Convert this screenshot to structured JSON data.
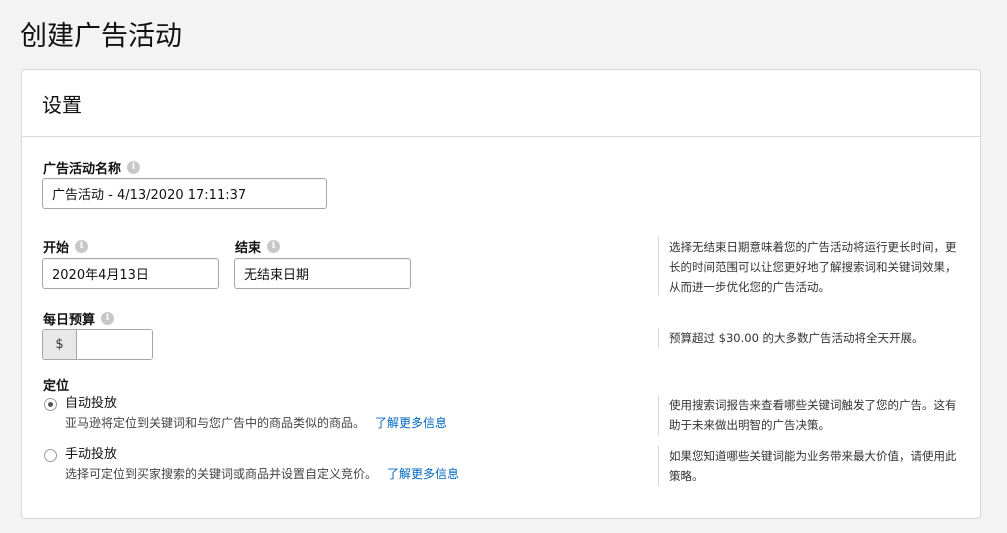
{
  "page": {
    "title": "创建广告活动"
  },
  "settings": {
    "header": "设置",
    "campaign_name": {
      "label": "广告活动名称",
      "value": "广告活动 - 4/13/2020 17:11:37"
    },
    "start": {
      "label": "开始",
      "value": "2020年4月13日"
    },
    "end": {
      "label": "结束",
      "value": "无结束日期"
    },
    "date_hint": "选择无结束日期意味着您的广告活动将运行更长时间，更长的时间范围可以让您更好地了解搜索词和关键词效果，从而进一步优化您的广告活动。",
    "budget": {
      "label": "每日预算",
      "currency": "$",
      "value": ""
    },
    "budget_hint": "预算超过 $30.00 的大多数广告活动将全天开展。",
    "targeting": {
      "label": "定位",
      "auto": {
        "title": "自动投放",
        "desc": "亚马逊将定位到关键词和与您广告中的商品类似的商品。",
        "link": "了解更多信息",
        "selected": true,
        "hint": "使用搜索词报告来查看哪些关键词触发了您的广告。这有助于未来做出明智的广告决策。"
      },
      "manual": {
        "title": "手动投放",
        "desc": "选择可定位到买家搜索的关键词或商品并设置自定义竞价。",
        "link": "了解更多信息",
        "selected": false,
        "hint": "如果您知道哪些关键词能为业务带来最大价值，请使用此策略。"
      }
    }
  },
  "icons": {
    "info": "info-icon"
  },
  "colors": {
    "link": "#0066c0",
    "border": "#d5d9d9",
    "background": "#f3f3f3"
  }
}
